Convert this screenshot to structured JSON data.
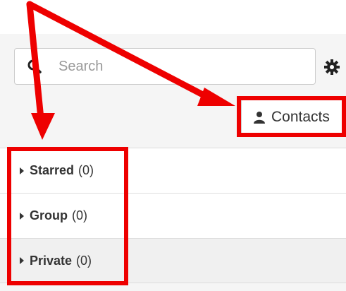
{
  "search": {
    "placeholder": "Search",
    "value": ""
  },
  "contacts_button": {
    "label": "Contacts"
  },
  "groups": [
    {
      "name": "Starred",
      "count": "(0)"
    },
    {
      "name": "Group",
      "count": "(0)"
    },
    {
      "name": "Private",
      "count": "(0)"
    }
  ],
  "colors": {
    "annotation": "#ee0000",
    "panel_bg": "#f5f5f5",
    "text": "#333333"
  },
  "icons": {
    "search": "search-icon",
    "settings": "gear-icon",
    "contacts": "person-icon",
    "expand": "caret-right-icon"
  }
}
